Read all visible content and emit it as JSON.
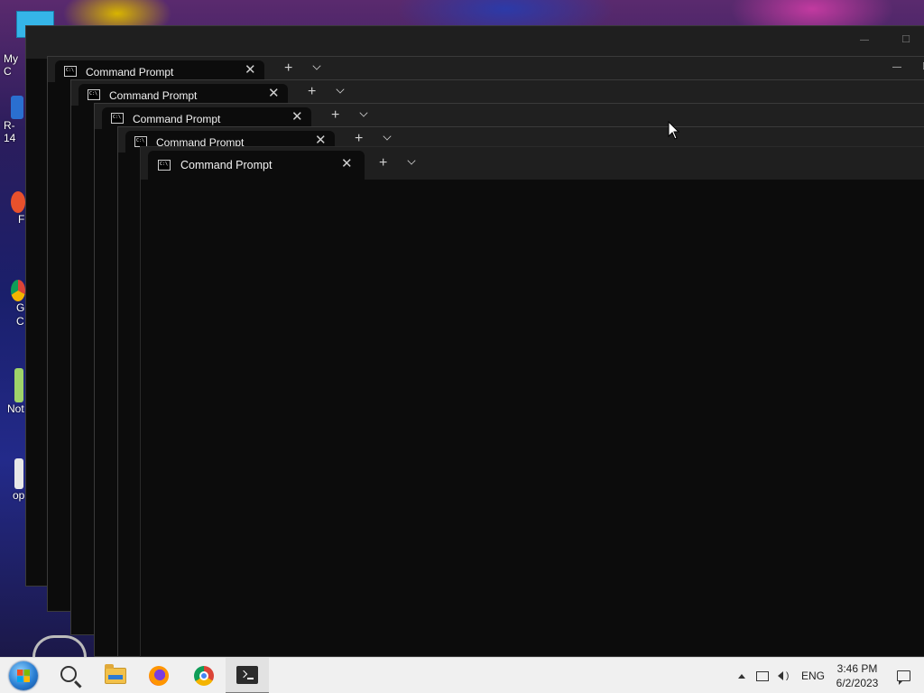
{
  "desktop": {
    "icons": [
      {
        "label": "My C"
      },
      {
        "label": "R-14"
      },
      {
        "label": "F"
      },
      {
        "label": "G\nC"
      },
      {
        "label": "Not"
      },
      {
        "label": "op"
      }
    ]
  },
  "windows": {
    "tab_title": "Command Prompt",
    "close_glyph": "✕",
    "newtab_glyph": "+",
    "minimize_glyph": "—",
    "maximize_glyph": "□"
  },
  "taskbar": {
    "pinned": [
      "start-button",
      "search",
      "file-explorer",
      "firefox",
      "chrome",
      "windows-terminal"
    ],
    "active": "windows-terminal",
    "language": "ENG",
    "time": "3:46 PM",
    "date": "6/2/2023"
  }
}
